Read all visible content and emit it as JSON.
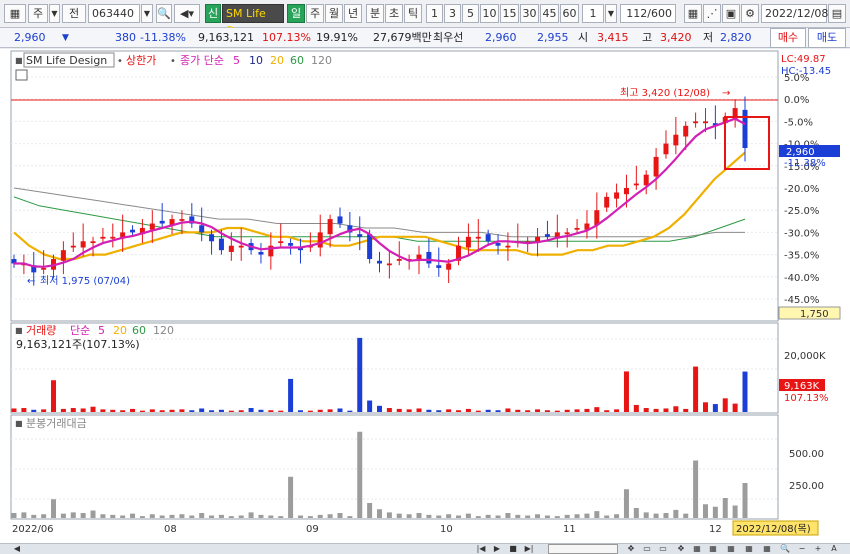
{
  "toolbar": {
    "market": "주",
    "market2": "전",
    "code": "063440",
    "mode_sin": "신",
    "stock_name": "SM Life De",
    "period_day": "일",
    "period_week": "주",
    "period_month": "월",
    "period_year": "년",
    "period_min": "분",
    "period_sec": "초",
    "period_tick": "틱",
    "intervals": [
      "1",
      "3",
      "5",
      "10",
      "15",
      "30",
      "45",
      "60"
    ],
    "interval_sel": "1",
    "count": "112/600",
    "date": "2022/12/08"
  },
  "quote": {
    "price": "2,960",
    "change": "380",
    "change_pct": "-11.38%",
    "volume": "9,163,121",
    "vol_ratio": "107.13%",
    "turnover": "19.91%",
    "amount": "27,679백만",
    "best_label": "최우선",
    "best_ask": "2,960",
    "best_bid": "2,955",
    "open_label": "시",
    "open": "3,415",
    "high_label": "고",
    "high": "3,420",
    "low_label": "저",
    "low": "2,820",
    "buy": "매수",
    "sell": "매도"
  },
  "price_panel": {
    "stock_label": "SM Life Design",
    "upper_limit": "상한가",
    "ma_label": "종가 단순",
    "ma_periods": [
      "5",
      "10",
      "20",
      "60",
      "120"
    ],
    "lc": "LC:49.87",
    "hc": "HC:-13.45",
    "current_tag": "2,960",
    "current_pct": "-11.38%",
    "high_note": "최고 3,420 (12/08)",
    "low_note": "최저 1,975 (07/04)",
    "cursor_value": "1,750",
    "axis_ticks": [
      "5.0%",
      "0.0%",
      "-5.0%",
      "-10.0%",
      "-15.0%",
      "-20.0%",
      "-25.0%",
      "-30.0%",
      "-35.0%",
      "-40.0%",
      "-45.0%"
    ]
  },
  "volume_panel": {
    "label": "거래량",
    "ma_label": "단순",
    "ma_periods": [
      "5",
      "20",
      "60",
      "120"
    ],
    "value_text": "9,163,121주(107.13%)",
    "axis_ticks": [
      "20,000K",
      "10,000K"
    ],
    "tag_value": "9,163K",
    "tag_pct": "107.13%"
  },
  "amount_panel": {
    "label": "분봉거래대금",
    "axis_ticks": [
      "500.00",
      "250.00"
    ]
  },
  "x_axis": {
    "labels": [
      "2022/06",
      "08",
      "09",
      "10",
      "11",
      "12"
    ],
    "cursor_date": "2022/12/08(목)"
  },
  "colors": {
    "up": "#e81515",
    "down": "#1b3fd6",
    "ma5": "#d21fb4",
    "ma10": "#1d2a8a",
    "ma20": "#f0b000",
    "ma60": "#2d9a45",
    "ma120": "#8a8a8a"
  },
  "chart_data": {
    "type": "line",
    "x_label_positions": [
      "2022/06",
      "08",
      "09",
      "10",
      "11",
      "12"
    ],
    "ylim_pct": [
      -45,
      5
    ],
    "price_pct_close": [
      -37,
      -37,
      -39,
      -38,
      -36,
      -34,
      -33,
      -32,
      -32,
      -31,
      -31,
      -30,
      -30,
      -29,
      -28,
      -28,
      -27,
      -27,
      -28,
      -30,
      -32,
      -34,
      -33,
      -33,
      -34,
      -35,
      -33,
      -32,
      -33,
      -34,
      -33,
      -30,
      -27,
      -28,
      -30,
      -31,
      -36,
      -37,
      -37,
      -36,
      -36,
      -35,
      -37,
      -38,
      -37,
      -33,
      -31,
      -31,
      -32,
      -33,
      -33,
      -32,
      -32,
      -31,
      -31,
      -30,
      -30,
      -29,
      -28,
      -25,
      -22,
      -21,
      -20,
      -19,
      -17,
      -13,
      -10,
      -8,
      -6,
      -5,
      -5,
      -6,
      -4,
      -2,
      -11
    ],
    "ma20_pct": [
      -30,
      -33,
      -35,
      -36,
      -36,
      -35,
      -35,
      -34,
      -33,
      -32,
      -31,
      -30,
      -30,
      -30,
      -29,
      -29,
      -30,
      -31,
      -31,
      -32,
      -32,
      -33,
      -33,
      -32,
      -31,
      -31,
      -31,
      -31,
      -32,
      -33,
      -34,
      -34,
      -34,
      -34,
      -35,
      -35,
      -35,
      -34,
      -34,
      -33,
      -33,
      -32,
      -31,
      -29,
      -26,
      -22,
      -18,
      -15,
      -12
    ],
    "ma60_pct": [
      -22,
      -24,
      -25,
      -26,
      -27,
      -28,
      -29,
      -30,
      -31,
      -31,
      -31,
      -31,
      -31,
      -31,
      -31,
      -31,
      -32,
      -32,
      -32,
      -32,
      -32,
      -32,
      -32,
      -32,
      -32,
      -32,
      -32,
      -31,
      -29,
      -27
    ],
    "ma120_pct": [
      -20,
      -21,
      -22,
      -23,
      -24,
      -25,
      -26,
      -27,
      -27,
      -28,
      -28,
      -28,
      -29,
      -29,
      -30,
      -30,
      -30,
      -31,
      -31,
      -31,
      -31,
      -31,
      -31,
      -31,
      -30,
      -30
    ],
    "volume_k": [
      800,
      900,
      500,
      600,
      7200,
      700,
      900,
      800,
      1200,
      600,
      500,
      400,
      700,
      300,
      600,
      400,
      500,
      600,
      400,
      800,
      400,
      500,
      300,
      400,
      900,
      500,
      400,
      300,
      7500,
      400,
      300,
      500,
      600,
      800,
      300,
      16800,
      2600,
      1400,
      900,
      700,
      600,
      800,
      500,
      400,
      600,
      400,
      700,
      300,
      500,
      400,
      800,
      500,
      400,
      600,
      400,
      300,
      500,
      600,
      700,
      1100,
      400,
      600,
      9200,
      1600,
      900,
      700,
      800,
      1300,
      700,
      10300,
      2200,
      1800,
      3100,
      1900,
      9163
    ],
    "amount": [
      40,
      45,
      25,
      30,
      150,
      35,
      45,
      40,
      60,
      30,
      25,
      20,
      35,
      15,
      30,
      20,
      25,
      30,
      20,
      40,
      20,
      25,
      15,
      20,
      45,
      25,
      20,
      15,
      330,
      20,
      15,
      25,
      30,
      40,
      15,
      690,
      120,
      70,
      45,
      35,
      30,
      40,
      25,
      20,
      30,
      20,
      35,
      15,
      25,
      20,
      40,
      25,
      20,
      30,
      20,
      15,
      25,
      30,
      35,
      55,
      20,
      30,
      230,
      80,
      45,
      35,
      40,
      65,
      35,
      460,
      110,
      90,
      160,
      100,
      280
    ]
  }
}
